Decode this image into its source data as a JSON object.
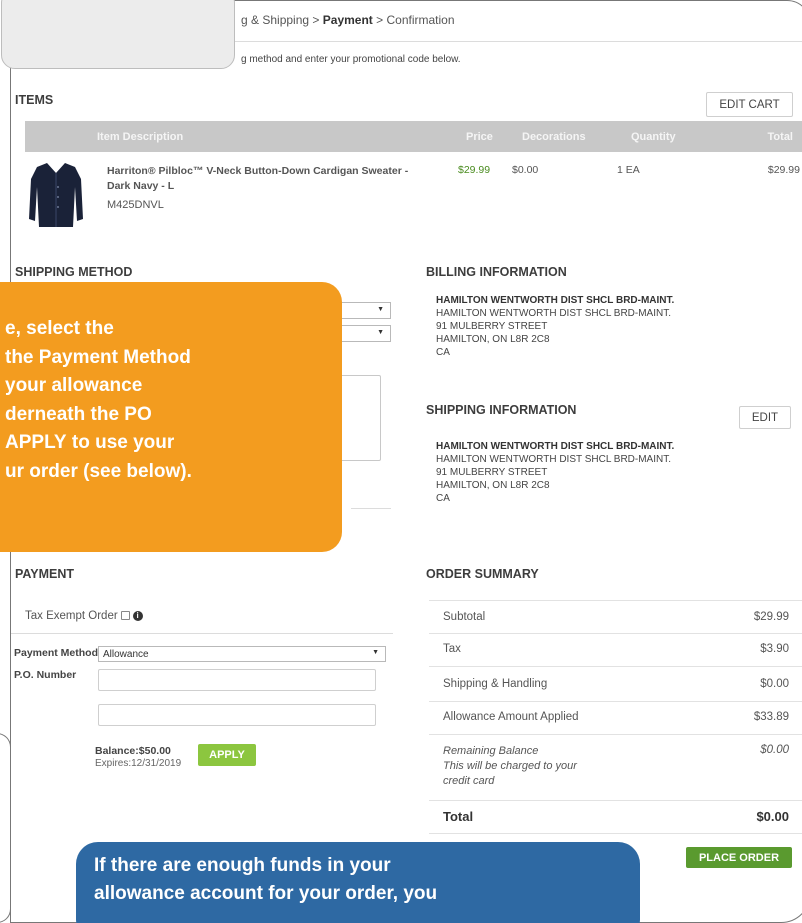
{
  "breadcrumb": {
    "prefix": "g & Shipping",
    "sep1": ">",
    "current": "Payment",
    "sep2": ">",
    "last": "Confirmation"
  },
  "intro_text": "g method and enter your promotional code below.",
  "items": {
    "title": "ITEMS",
    "edit_cart_label": "EDIT CART",
    "columns": {
      "description": "Item Description",
      "price": "Price",
      "decorations": "Decorations",
      "quantity": "Quantity",
      "total": "Total"
    },
    "rows": [
      {
        "description": "Harriton® Pilbloc™ V-Neck Button-Down Cardigan Sweater - Dark Navy - L",
        "sku": "M425DNVL",
        "price": "$29.99",
        "decorations": "$0.00",
        "quantity": "1 EA",
        "total": "$29.99"
      }
    ]
  },
  "shipping_method": {
    "title": "SHIPPING METHOD"
  },
  "callout_orange": {
    "line1": "e, select the",
    "line2_pre": "the ",
    "line2_bold": "Payment Method",
    "line3": "your allowance",
    "line4": "derneath the PO",
    "line5_bold": "APPLY",
    "line5_post": " to use your",
    "line6": "ur order (see below)."
  },
  "billing": {
    "title": "BILLING INFORMATION",
    "name": "HAMILTON WENTWORTH DIST SHCL BRD-MAINT.",
    "line2": "HAMILTON WENTWORTH DIST SHCL BRD-MAINT.",
    "street": "91 MULBERRY STREET",
    "city": "HAMILTON, ON L8R 2C8",
    "country": "CA"
  },
  "shipping_info": {
    "title": "SHIPPING INFORMATION",
    "edit_label": "EDIT",
    "name": "HAMILTON WENTWORTH DIST SHCL BRD-MAINT.",
    "line2": "HAMILTON WENTWORTH DIST SHCL BRD-MAINT.",
    "street": "91 MULBERRY STREET",
    "city": "HAMILTON, ON L8R 2C8",
    "country": "CA"
  },
  "payment": {
    "title": "PAYMENT",
    "tax_exempt_label": "Tax Exempt Order",
    "info_glyph": "i",
    "method_label": "Payment Method",
    "method_value": "Allowance",
    "po_label": "P.O. Number",
    "balance_label": "Balance:$50.00",
    "expires_label": "Expires:12/31/2019",
    "apply_label": "APPLY"
  },
  "order_summary": {
    "title": "ORDER SUMMARY",
    "subtotal_label": "Subtotal",
    "subtotal_value": "$29.99",
    "tax_label": "Tax",
    "tax_value": "$3.90",
    "shipping_label": "Shipping & Handling",
    "shipping_value": "$0.00",
    "allowance_label": "Allowance Amount Applied",
    "allowance_value": "$33.89",
    "remaining_label": "Remaining Balance",
    "remaining_note1": "This will be charged to your",
    "remaining_note2": "credit card",
    "remaining_value": "$0.00",
    "total_label": "Total",
    "total_value": "$0.00",
    "place_order_label": "PLACE ORDER"
  },
  "callout_blue": {
    "line1": "If there are enough funds in your",
    "line2": "allowance account for your order, you"
  },
  "colors": {
    "orange_callout": "#f39c1f",
    "blue_callout": "#2e69a3",
    "apply_green": "#8cc63f",
    "place_order_green": "#5a9a2f",
    "price_green": "#4a8c1f"
  }
}
